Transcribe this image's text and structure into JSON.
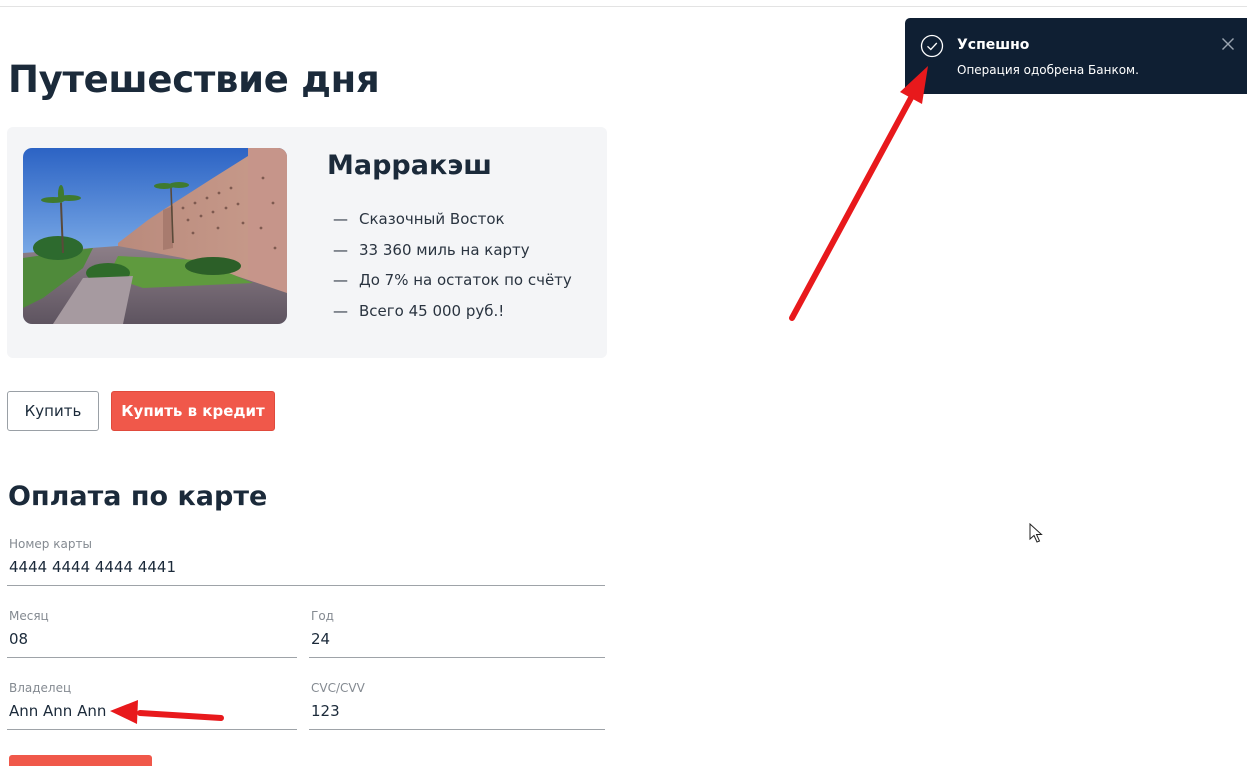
{
  "page": {
    "title": "Путешествие дня"
  },
  "offer": {
    "city": "Марракэш",
    "image": "marrakesh-city-wall-photo",
    "features": [
      {
        "dash": "—",
        "text": "Сказочный Восток"
      },
      {
        "dash": "—",
        "text": "33 360 миль на карту"
      },
      {
        "dash": "—",
        "text": "До 7% на остаток по счёту"
      },
      {
        "dash": "—",
        "text": "Всего 45 000 руб.!"
      }
    ]
  },
  "actions": {
    "buy_label": "Купить",
    "credit_label": "Купить в кредит"
  },
  "payment": {
    "title": "Оплата по карте",
    "card_number": {
      "label": "Номер карты",
      "value": "4444 4444 4444 4441"
    },
    "month": {
      "label": "Месяц",
      "value": "08"
    },
    "year": {
      "label": "Год",
      "value": "24"
    },
    "owner": {
      "label": "Владелец",
      "value": "Ann Ann Ann"
    },
    "cvc": {
      "label": "CVC/CVV",
      "value": "123"
    }
  },
  "notification": {
    "title": "Успешно",
    "text": "Операция одобрена Банком.",
    "icon": "check-circle-icon",
    "close_icon": "close-icon"
  },
  "colors": {
    "accent": "#f0584a",
    "heading": "#1b2a3a",
    "toast_bg": "#0f1f33",
    "card_bg": "#f4f5f7",
    "annotation_arrow": "#e8191c"
  }
}
